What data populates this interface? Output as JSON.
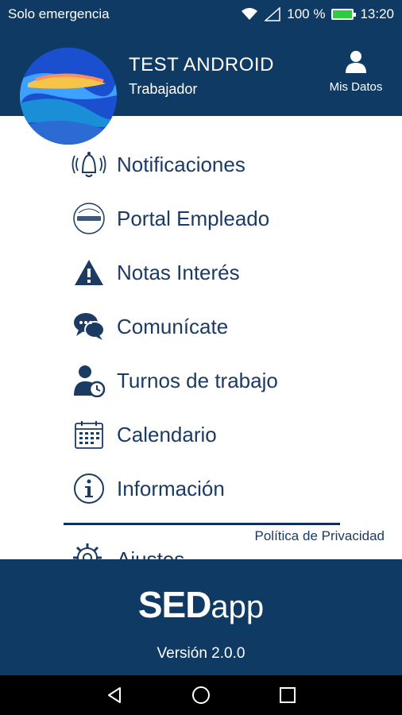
{
  "status_bar": {
    "carrier": "Solo emergencia",
    "battery": "100 %",
    "time": "13:20",
    "icons": [
      "wifi-icon",
      "signal-icon",
      "battery-icon"
    ]
  },
  "header": {
    "user_name": "TEST ANDROID",
    "user_role": "Trabajador",
    "mis_datos_label": "Mis Datos",
    "mis_datos_icon": "user-icon"
  },
  "menu": {
    "items": [
      {
        "label": "Notificaciones",
        "icon": "bell-icon"
      },
      {
        "label": "Portal Empleado",
        "icon": "portal-icon"
      },
      {
        "label": "Notas Interés",
        "icon": "warning-icon"
      },
      {
        "label": "Comunícate",
        "icon": "chat-icon"
      },
      {
        "label": "Turnos de trabajo",
        "icon": "user-clock-icon"
      },
      {
        "label": "Calendario",
        "icon": "calendar-icon"
      },
      {
        "label": "Información",
        "icon": "info-icon"
      }
    ],
    "privacy_link": "Política de Privacidad",
    "settings_label": "Ajustes",
    "settings_icon": "gear-icon"
  },
  "footer": {
    "brand_sed": "SED",
    "brand_app": "app",
    "version": "Versión 2.0.0"
  },
  "nav_bar": {
    "buttons": [
      "back-icon",
      "home-icon",
      "recents-icon"
    ]
  },
  "colors": {
    "primary": "#0f3a63",
    "text": "#1c3b63",
    "white": "#ffffff",
    "nav": "#000000"
  }
}
